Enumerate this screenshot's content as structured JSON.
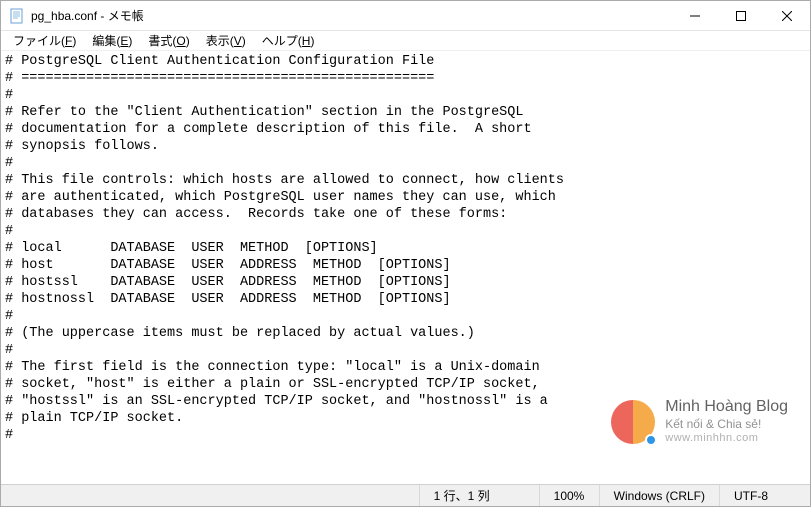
{
  "window": {
    "title": "pg_hba.conf - メモ帳"
  },
  "menu": {
    "file": {
      "label": "ファイル",
      "mnemonic": "F"
    },
    "edit": {
      "label": "編集",
      "mnemonic": "E"
    },
    "format": {
      "label": "書式",
      "mnemonic": "O"
    },
    "view": {
      "label": "表示",
      "mnemonic": "V"
    },
    "help": {
      "label": "ヘルプ",
      "mnemonic": "H"
    }
  },
  "editor": {
    "lines": [
      "# PostgreSQL Client Authentication Configuration File",
      "# ===================================================",
      "#",
      "# Refer to the \"Client Authentication\" section in the PostgreSQL",
      "# documentation for a complete description of this file.  A short",
      "# synopsis follows.",
      "#",
      "# This file controls: which hosts are allowed to connect, how clients",
      "# are authenticated, which PostgreSQL user names they can use, which",
      "# databases they can access.  Records take one of these forms:",
      "#",
      "# local      DATABASE  USER  METHOD  [OPTIONS]",
      "# host       DATABASE  USER  ADDRESS  METHOD  [OPTIONS]",
      "# hostssl    DATABASE  USER  ADDRESS  METHOD  [OPTIONS]",
      "# hostnossl  DATABASE  USER  ADDRESS  METHOD  [OPTIONS]",
      "#",
      "# (The uppercase items must be replaced by actual values.)",
      "#",
      "# The first field is the connection type: \"local\" is a Unix-domain",
      "# socket, \"host\" is either a plain or SSL-encrypted TCP/IP socket,",
      "# \"hostssl\" is an SSL-encrypted TCP/IP socket, and \"hostnossl\" is a",
      "# plain TCP/IP socket.",
      "#"
    ]
  },
  "status": {
    "position": "1 行、1 列",
    "zoom": "100%",
    "line_ending": "Windows (CRLF)",
    "encoding": "UTF-8"
  },
  "watermark": {
    "title": "Minh Hoàng Blog",
    "subtitle": "Kết nối & Chia sẻ!",
    "url": "www.minhhn.com"
  }
}
